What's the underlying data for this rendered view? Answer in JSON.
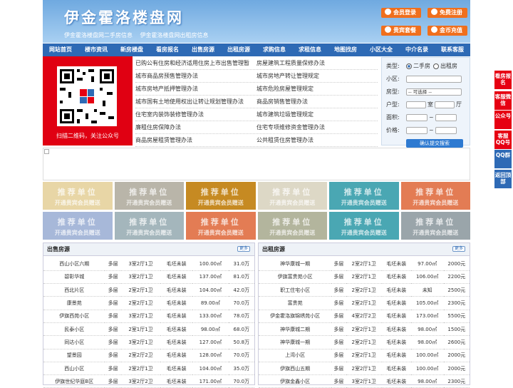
{
  "header": {
    "title": "伊金霍洛楼盘网",
    "sub1": "伊金霍洛楼盘网二手房信息",
    "sub2": "伊金霍洛楼盘网出租房信息",
    "login": "会员登录",
    "register": "免费注册",
    "packages": "贵宾套餐",
    "recharge": "金币充值"
  },
  "nav": [
    "网站首页",
    "楼市资讯",
    "新房楼盘",
    "看房报名",
    "出售房源",
    "出租房源",
    "求购信息",
    "求租信息",
    "地图找房",
    "小区大全",
    "中介名录",
    "联系客服"
  ],
  "qr_caption": "扫描二维码，关注公众号",
  "policy_links": [
    [
      "已购公有住房和经济适用住房上市出售管理暂",
      "房屋建筑工程质量保修办法"
    ],
    [
      "城市商品房预售管理办法",
      "城市房地产转让管理规定"
    ],
    [
      "城市房地产抵押管理办法",
      "城市危险房屋管理规定"
    ],
    [
      "城市国有土地使用权出让转让规划管理办法",
      "商品房销售管理办法"
    ],
    [
      "住宅室内装饰装修管理办法",
      "城市建筑垃圾管理规定"
    ],
    [
      "廉租住房保障办法",
      "住宅专项维修资金管理办法"
    ],
    [
      "商品房屋租赁管理办法",
      "公共租赁住房管理办法"
    ]
  ],
  "search": {
    "type_label": "类型:",
    "opt_sale": "二手房",
    "opt_rent": "出租房",
    "estate_label": "小区:",
    "housetype_label": "房型:",
    "housetype_value": "-- 可选择 --",
    "layout_label": "户型:",
    "room_unit": "室",
    "hall_unit": "厅",
    "area_label": "面积:",
    "price_label": "价格:",
    "range_sep": "~",
    "submit": "确认提交搜索"
  },
  "tiles": {
    "line1": "推荐单位",
    "line2": "开通贵宾会员赠送",
    "colors": [
      "#e8d6a6",
      "#b9b5a9",
      "#c68a22",
      "#ddd8c6",
      "#4aa7b3",
      "#e37c54",
      "#a7b8d9",
      "#a4b6bc",
      "#e37c54",
      "#b3b59d",
      "#4aa7b3",
      "#9aa5aa"
    ]
  },
  "sale": {
    "title": "出售房源",
    "more": "更多",
    "rows": [
      [
        "西山小区六期",
        "多层",
        "3室2厅1卫",
        "毛坯未装",
        "100.00㎡",
        "31.0万"
      ],
      [
        "碧彰华城",
        "多层",
        "3室2厅1卫",
        "毛坯未装",
        "137.00㎡",
        "81.0万"
      ],
      [
        "西北片区",
        "多层",
        "2室2厅1卫",
        "毛坯未装",
        "104.00㎡",
        "42.0万"
      ],
      [
        "康景苑",
        "多层",
        "2室2厅1卫",
        "毛坯未装",
        "89.00㎡",
        "70.0万"
      ],
      [
        "伊旗西苑小区",
        "多层",
        "3室2厅1卫",
        "毛坯未装",
        "133.00㎡",
        "78.0万"
      ],
      [
        "民泰小区",
        "多层",
        "2室1厅1卫",
        "毛坯未装",
        "98.00㎡",
        "68.0万"
      ],
      [
        "同达小区",
        "多层",
        "3室2厅1卫",
        "毛坯未装",
        "127.00㎡",
        "50.8万"
      ],
      [
        "望景园",
        "多层",
        "2室2厅2卫",
        "毛坯未装",
        "128.00㎡",
        "70.0万"
      ],
      [
        "西山小区",
        "多层",
        "2室2厅1卫",
        "毛坯未装",
        "104.00㎡",
        "35.0万"
      ],
      [
        "伊旗世纪华庭B区",
        "多层",
        "3室2厅2卫",
        "毛坯未装",
        "171.00㎡",
        "70.0万"
      ]
    ]
  },
  "rent": {
    "title": "出租房源",
    "more": "更多",
    "rows": [
      [
        "神华康城一期",
        "多层",
        "2室2厅1卫",
        "毛坯未装",
        "97.00㎡",
        "2000元"
      ],
      [
        "伊旗富贵苑小区",
        "多层",
        "2室2厅1卫",
        "毛坯未装",
        "106.00㎡",
        "2200元"
      ],
      [
        "职工住宅小区",
        "多层",
        "2室2厅1卫",
        "毛坯未装",
        "未知",
        "2500元"
      ],
      [
        "富贵苑",
        "多层",
        "2室2厅1卫",
        "毛坯未装",
        "105.00㎡",
        "2300元"
      ],
      [
        "伊金霍洛旗锦绣苑小区",
        "多层",
        "4室2厅2卫",
        "毛坯未装",
        "173.00㎡",
        "5500元"
      ],
      [
        "神华康城二期",
        "多层",
        "2室2厅1卫",
        "毛坯未装",
        "98.00㎡",
        "1500元"
      ],
      [
        "神华康城一期",
        "多层",
        "2室2厅1卫",
        "毛坯未装",
        "98.00㎡",
        "2600元"
      ],
      [
        "上湾小区",
        "多层",
        "2室2厅1卫",
        "毛坯未装",
        "100.00㎡",
        "2000元"
      ],
      [
        "伊旗西山五期",
        "多层",
        "2室2厅1卫",
        "毛坯未装",
        "100.00㎡",
        "2000元"
      ],
      [
        "伊旗金鑫小区",
        "多层",
        "3室2厅1卫",
        "毛坯未装",
        "98.00㎡",
        "2300元"
      ]
    ]
  },
  "side": [
    {
      "label": "看房报名",
      "color": "#e60012"
    },
    {
      "label": "客服微信",
      "color": "#e60012"
    },
    {
      "label": "公众号",
      "color": "#e60012"
    },
    {
      "label": "客服QQ号",
      "color": "#e60012"
    },
    {
      "label": "QQ群",
      "color": "#2e6ab5"
    },
    {
      "label": "返回顶部",
      "color": "#2e6ab5"
    }
  ]
}
